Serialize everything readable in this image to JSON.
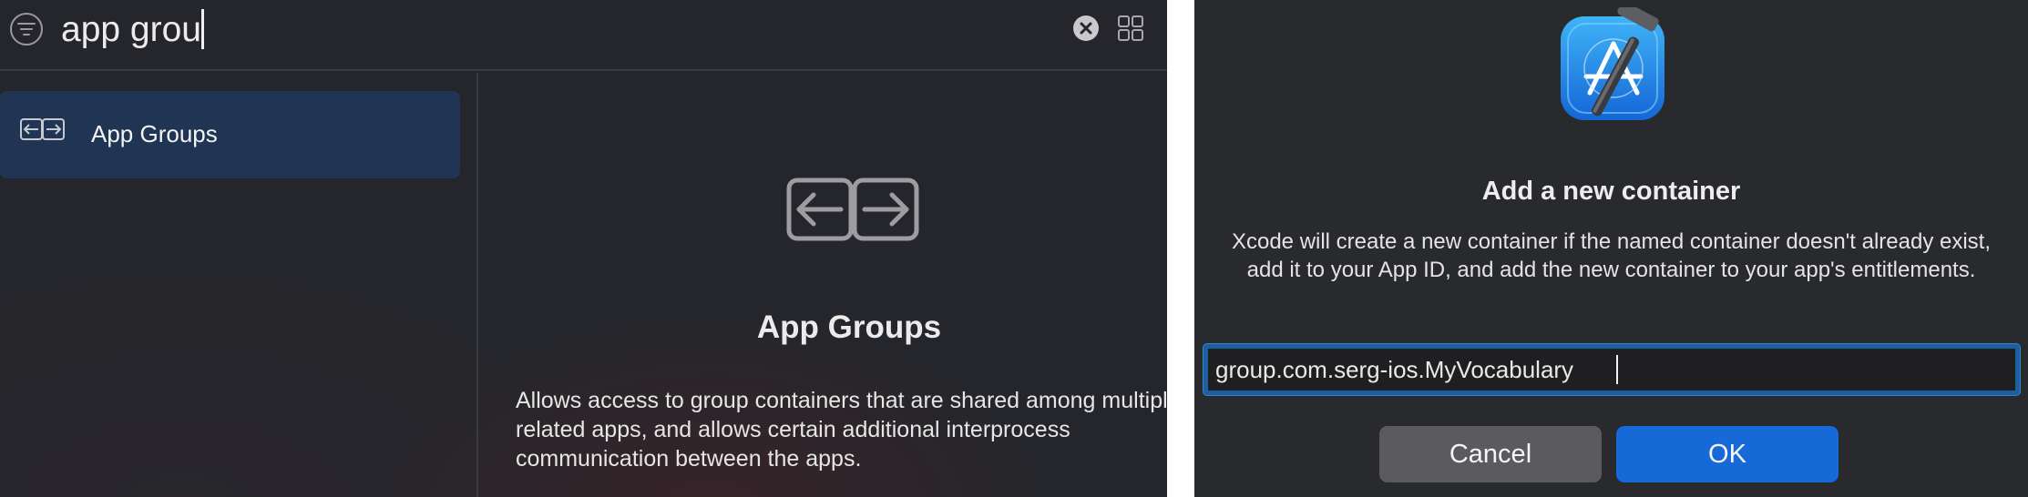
{
  "search": {
    "query": "app grou",
    "filter_icon": "filter-icon",
    "clear_icon": "clear-icon",
    "grid_icon": "grid-view-icon"
  },
  "capability_list": {
    "items": [
      {
        "label": "App Groups",
        "icon": "app-groups-icon",
        "selected": true
      }
    ]
  },
  "detail": {
    "icon": "app-groups-icon",
    "title": "App Groups",
    "description": "Allows access to group containers that are shared among multiple related apps, and allows certain additional interprocess communication between the apps."
  },
  "dialog": {
    "icon": "xcode-icon",
    "title": "Add a new container",
    "message": "Xcode will create a new container if the named container doesn't already exist, add it to your App ID, and add the new container to your app's entitlements.",
    "field_value": "group.com.serg-ios.MyVocabulary",
    "cancel_label": "Cancel",
    "ok_label": "OK"
  },
  "colors": {
    "accent": "#1769d8",
    "selection": "#1f3553",
    "background": "#25262b"
  }
}
